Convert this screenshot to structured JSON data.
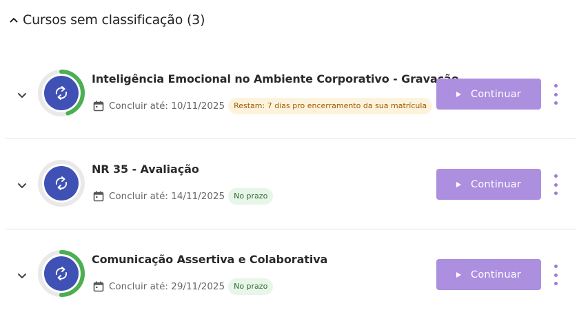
{
  "section": {
    "title": "Cursos sem classificação (3)"
  },
  "colors": {
    "accent": "#ad8fe0",
    "progress": "#4caf50",
    "icon_bg": "#3f51b5",
    "warn_bg": "#fdf3dc",
    "ok_bg": "#e8f5e9"
  },
  "courses": [
    {
      "title": "Inteligência Emocional no Ambiente Corporativo - Gravação",
      "due": "Concluir até: 10/11/2025",
      "badge": "Restam: 7 dias pro encerramento da sua matrícula",
      "badge_status": "warning",
      "progress_fraction": 0.45,
      "button": "Continuar",
      "icon": "sync-icon"
    },
    {
      "title": "NR 35 - Avaliação",
      "due": "Concluir até: 14/11/2025",
      "badge": "No prazo",
      "badge_status": "ok",
      "progress_fraction": 0.0,
      "button": "Continuar",
      "icon": "sync-icon"
    },
    {
      "title": "Comunicação Assertiva e Colaborativa",
      "due": "Concluir até: 29/11/2025",
      "badge": "No prazo",
      "badge_status": "ok",
      "progress_fraction": 0.5,
      "button": "Continuar",
      "icon": "sync-icon"
    }
  ]
}
